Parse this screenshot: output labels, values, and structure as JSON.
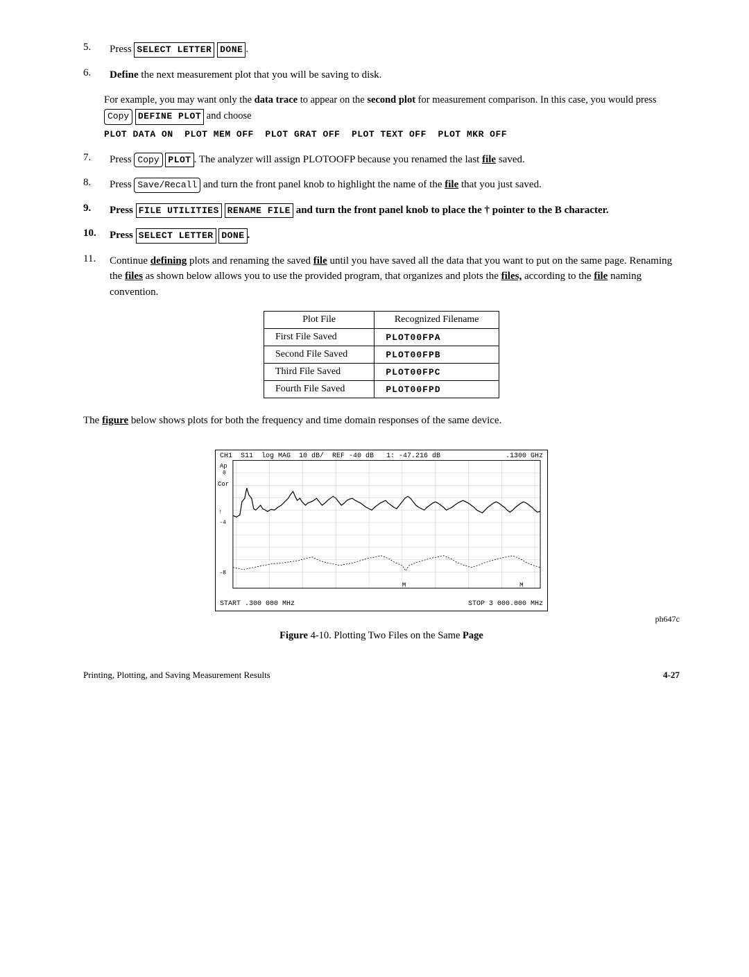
{
  "steps": [
    {
      "num": "5.",
      "text": "Press",
      "keys": [
        "SELECT LETTER",
        "DONE"
      ],
      "suffix": "."
    },
    {
      "num": "6.",
      "text": "Define the next measurement plot that you will be saving to disk."
    }
  ],
  "example": {
    "text1": "For example, you may want only the data trace to appear on the second plot for measurement comparison. In this case, you would press",
    "btn": "Copy",
    "key1": "DEFINE PLOT",
    "text2": "and choose",
    "line2": "PLOT DATA ON  PLOT MEM OFF  PLOT GRAT OFF  PLOT TEXT OFF  PLOT MKR OFF"
  },
  "step7": {
    "num": "7.",
    "btn": "Copy",
    "key": "PLOT",
    "text": ". The analyzer will assign PLOTOOFP because you renamed the last",
    "ul": "file",
    "text2": "saved."
  },
  "step8": {
    "num": "8.",
    "btn": "Save/Recall",
    "text": "and turn the front panel knob to highlight the name of the",
    "ul": "file",
    "text2": "that you just saved."
  },
  "step9": {
    "num": "9.",
    "text": "Press",
    "keys": [
      "FILE UTILITIES",
      "RENAME FILE"
    ],
    "text2": "and turn the front panel knob to place the † pointer to the B character."
  },
  "step10": {
    "num": "10.",
    "text": "Press",
    "keys": [
      "SELECT LETTER",
      "DONE"
    ],
    "suffix": "."
  },
  "step11": {
    "num": "11.",
    "text1": "Continue",
    "ul1": "defining",
    "text2": "plots and renaming the saved",
    "ul2": "file",
    "text3": "until you have saved all the data that you want to put on the same page. Renaming the",
    "ul3": "files",
    "text4": "as shown below allows you to use the provided program, that organizes and plots the",
    "ul4": "files,",
    "text5": "according to the",
    "ul5": "file",
    "text6": "naming convention."
  },
  "table": {
    "headers": [
      "Plot File",
      "Recognized Filename"
    ],
    "rows": [
      [
        "First File Saved",
        "PLOT00FPA"
      ],
      [
        "Second File Saved",
        "PLOT00FPB"
      ],
      [
        "Third File Saved",
        "PLOT00FPC"
      ],
      [
        "Fourth File Saved",
        "PLOT00FPD"
      ]
    ]
  },
  "figure_text": {
    "intro1": "The",
    "ul": "figure",
    "intro2": "below shows plots for both the frequency and time domain responses of the same device."
  },
  "plot": {
    "header_left": "CH1  S11  log MAG  10 dB/  REF -40 dB  1: -47.216 dB",
    "header_right": ".1300 GHz",
    "label_ap": "Ap",
    "label_cor": "Cor",
    "footer_left": "START .300 000 MHz",
    "footer_right": "STOP 3 000.000 MHz"
  },
  "caption": {
    "bold": "Figure",
    "text": " 4-10. Plotting Two Files on the Same ",
    "bold2": "Page"
  },
  "footer": {
    "left": "Printing, Plotting, and Saving Measurement Results",
    "right": "4-27",
    "ref": "ph647c"
  }
}
